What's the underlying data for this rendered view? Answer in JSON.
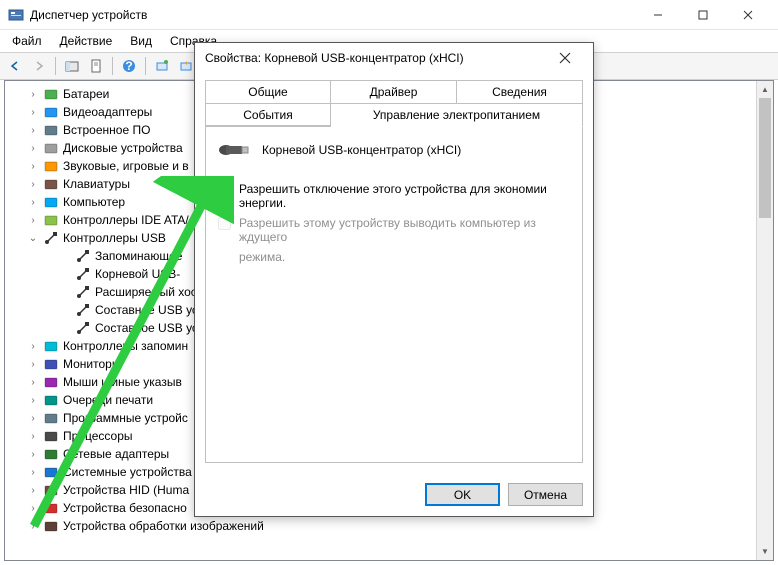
{
  "window": {
    "title": "Диспетчер устройств"
  },
  "menu": {
    "file": "Файл",
    "action": "Действие",
    "view": "Вид",
    "help": "Справка"
  },
  "tree": {
    "items": [
      {
        "label": "Батареи",
        "icon": "battery"
      },
      {
        "label": "Видеоадаптеры",
        "icon": "display"
      },
      {
        "label": "Встроенное ПО",
        "icon": "firmware"
      },
      {
        "label": "Дисковые устройства",
        "icon": "disk"
      },
      {
        "label": "Звуковые, игровые и в",
        "icon": "audio"
      },
      {
        "label": "Клавиатуры",
        "icon": "keyboard"
      },
      {
        "label": "Компьютер",
        "icon": "computer"
      },
      {
        "label": "Контроллеры IDE ATA/",
        "icon": "ide"
      },
      {
        "label": "Контроллеры USB",
        "icon": "usb",
        "expanded": true,
        "children": [
          {
            "label": "Запоминающее",
            "icon": "usb"
          },
          {
            "label": "Корневой USB-",
            "icon": "usb"
          },
          {
            "label": "Расширяемый хост",
            "icon": "usb"
          },
          {
            "label": "Составное USB устр",
            "icon": "usb"
          },
          {
            "label": "Составное USB устр",
            "icon": "usb"
          }
        ]
      },
      {
        "label": "Контроллеры запомин",
        "icon": "storage"
      },
      {
        "label": "Мониторы",
        "icon": "monitor"
      },
      {
        "label": "Мыши и иные указыв",
        "icon": "mouse"
      },
      {
        "label": "Очереди печати",
        "icon": "printer"
      },
      {
        "label": "Программные устройс",
        "icon": "software"
      },
      {
        "label": "Процессоры",
        "icon": "cpu"
      },
      {
        "label": "Сетевые адаптеры",
        "icon": "network"
      },
      {
        "label": "Системные устройства",
        "icon": "system"
      },
      {
        "label": "Устройства HID (Huma",
        "icon": "hid"
      },
      {
        "label": "Устройства безопасно",
        "icon": "security"
      },
      {
        "label": "Устройства обработки изображений",
        "icon": "imaging"
      }
    ]
  },
  "dialog": {
    "title": "Свойства: Корневой USB-концентратор (xHCI)",
    "tabs": {
      "general": "Общие",
      "driver": "Драйвер",
      "details": "Сведения",
      "events": "События",
      "power": "Управление электропитанием"
    },
    "device_name": "Корневой USB-концентратор (xHCI)",
    "checkbox1": "Разрешить отключение этого устройства для экономии энергии.",
    "checkbox2_line1": "Разрешить этому устройству выводить компьютер из ждущего",
    "checkbox2_line2": "режима.",
    "ok": "OK",
    "cancel": "Отмена"
  }
}
